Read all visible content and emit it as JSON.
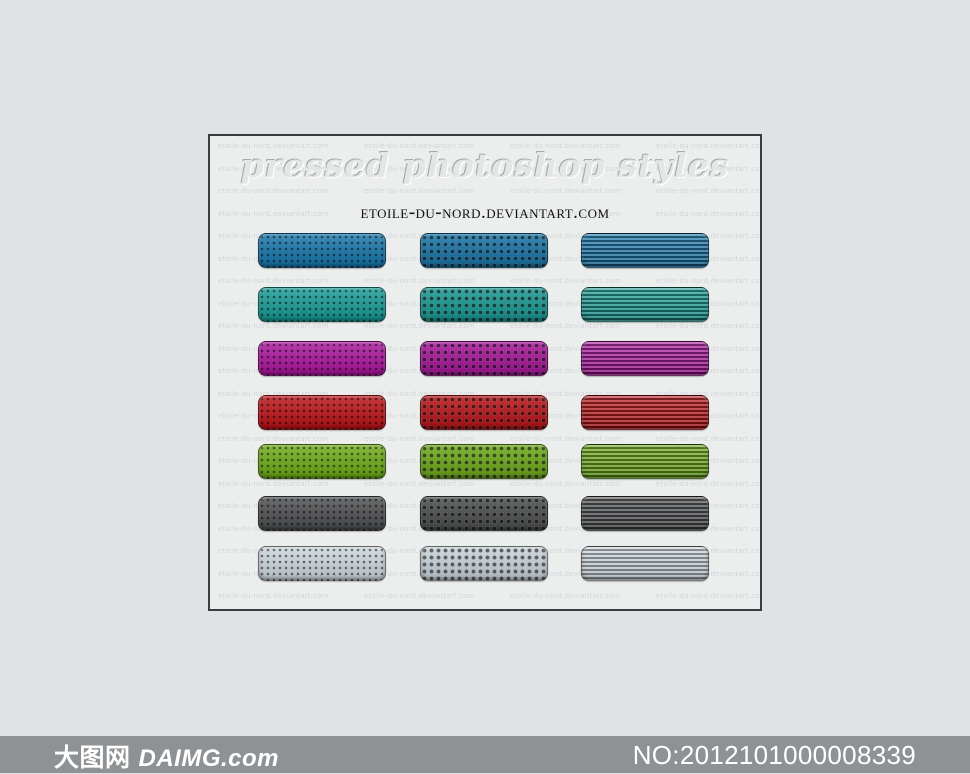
{
  "poster": {
    "title": "pressed photoshop styles",
    "subtitle": "etoile-du-nord.deviantart.com",
    "watermark_text": "etoile-du-nord.deviantart.com"
  },
  "swatch_rows": [
    {
      "color": "#1473a8",
      "name": "blue"
    },
    {
      "color": "#149892",
      "name": "teal"
    },
    {
      "color": "#a8129a",
      "name": "magenta"
    },
    {
      "color": "#b80f14",
      "name": "red"
    },
    {
      "color": "#6aa814",
      "name": "green"
    },
    {
      "color": "#4a4c4e",
      "name": "dark-gray"
    },
    {
      "color": "#c9d4da",
      "name": "light-gray"
    }
  ],
  "swatch_patterns": [
    "dots",
    "grid",
    "lines"
  ],
  "footer": {
    "brand_cn": "大图网",
    "brand_domain": "DAIMG.com",
    "number": "NO:20121010000 08339"
  }
}
